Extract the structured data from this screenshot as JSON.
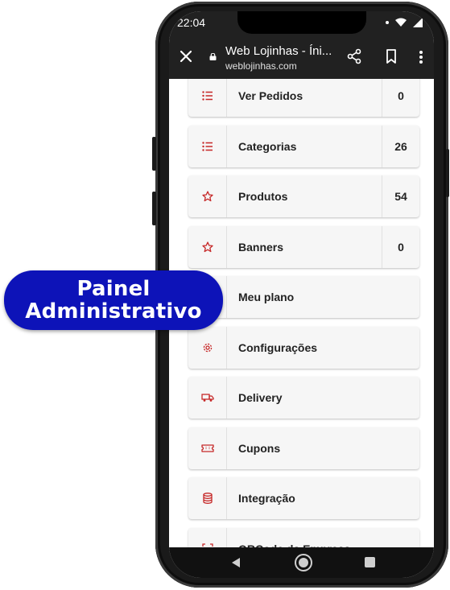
{
  "status": {
    "time": "22:04"
  },
  "browser": {
    "title": "Web Lojinhas - Íni...",
    "url": "weblojinhas.com"
  },
  "menu": [
    {
      "label": "Ver Pedidos",
      "count": "0",
      "icon": "list-icon"
    },
    {
      "label": "Categorias",
      "count": "26",
      "icon": "list-icon"
    },
    {
      "label": "Produtos",
      "count": "54",
      "icon": "star-icon"
    },
    {
      "label": "Banners",
      "count": "0",
      "icon": "star-icon"
    },
    {
      "label": "Meu plano",
      "count": "",
      "icon": "plan-icon"
    },
    {
      "label": "Configurações",
      "count": "",
      "icon": "gear-icon"
    },
    {
      "label": "Delivery",
      "count": "",
      "icon": "truck-icon"
    },
    {
      "label": "Cupons",
      "count": "",
      "icon": "ticket-icon"
    },
    {
      "label": "Integração",
      "count": "",
      "icon": "database-icon"
    },
    {
      "label": "QRCode da Empresa",
      "count": "",
      "icon": "qrcode-icon"
    }
  ],
  "badge": {
    "line1": "Painel",
    "line2": "Administrativo"
  },
  "colors": {
    "icon": "#c62828",
    "badge": "#0d13b8",
    "bar": "#212121"
  }
}
